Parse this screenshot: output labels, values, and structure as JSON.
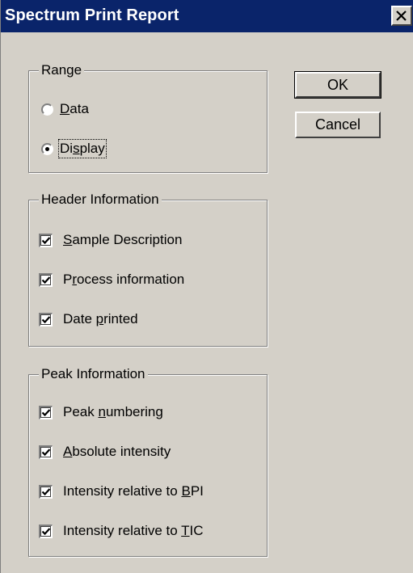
{
  "window": {
    "title": "Spectrum Print Report",
    "close_icon": "close-icon"
  },
  "range": {
    "legend": "Range",
    "options": [
      {
        "pre": "",
        "accel": "D",
        "post": "ata",
        "checked": false
      },
      {
        "pre": "Di",
        "accel": "s",
        "post": "play",
        "checked": true
      }
    ]
  },
  "header_info": {
    "legend": "Header Information",
    "items": [
      {
        "pre": "",
        "accel": "S",
        "post": "ample Description",
        "checked": true
      },
      {
        "pre": "P",
        "accel": "r",
        "post": "ocess information",
        "checked": true
      },
      {
        "pre": "Date ",
        "accel": "p",
        "post": "rinted",
        "checked": true
      }
    ]
  },
  "peak_info": {
    "legend": "Peak Information",
    "items": [
      {
        "pre": "Peak ",
        "accel": "n",
        "post": "umbering",
        "checked": true
      },
      {
        "pre": "",
        "accel": "A",
        "post": "bsolute intensity",
        "checked": true
      },
      {
        "pre": "Intensity relative to ",
        "accel": "B",
        "post": "PI",
        "checked": true
      },
      {
        "pre": "Intensity relative to ",
        "accel": "T",
        "post": "IC",
        "checked": true
      }
    ]
  },
  "buttons": {
    "ok_label": "OK",
    "cancel_label": "Cancel"
  }
}
